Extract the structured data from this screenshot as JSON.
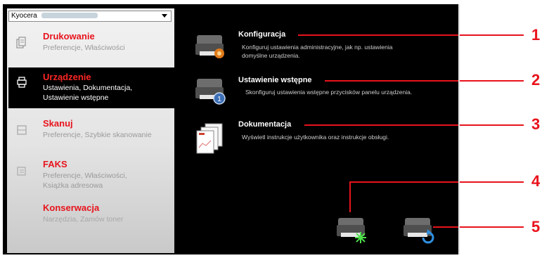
{
  "printer_select": {
    "value": "Kyocera"
  },
  "nav": [
    {
      "title": "Drukowanie",
      "sub": "Preferencje, Właściwości"
    },
    {
      "title": "Urządzenie",
      "sub": "Ustawienia, Dokumentacja, Ustawienie wstępne"
    },
    {
      "title": "Skanuj",
      "sub": "Preferencje, Szybkie skanowanie"
    },
    {
      "title": "FAKS",
      "sub": "Preferencje, Właściwości, Książka adresowa"
    },
    {
      "title": "Konserwacja",
      "sub": "Narzędzia, Zamów toner"
    }
  ],
  "functions": [
    {
      "title": "Konfiguracja",
      "desc": "Konfiguruj ustawienia administracyjne, jak np. ustawienia domyślne urządzenia."
    },
    {
      "title": "Ustawienie wstępne",
      "desc": "Skonfiguruj ustawienia wstępne przycisków panelu urządzenia."
    },
    {
      "title": "Dokumentacja",
      "desc": "Wyświetl instrukcje użytkownika oraz instrukcje obsługi."
    }
  ],
  "callouts": [
    "1",
    "2",
    "3",
    "4",
    "5"
  ],
  "colors": {
    "accent": "#e8131c",
    "panel": "#000000"
  }
}
